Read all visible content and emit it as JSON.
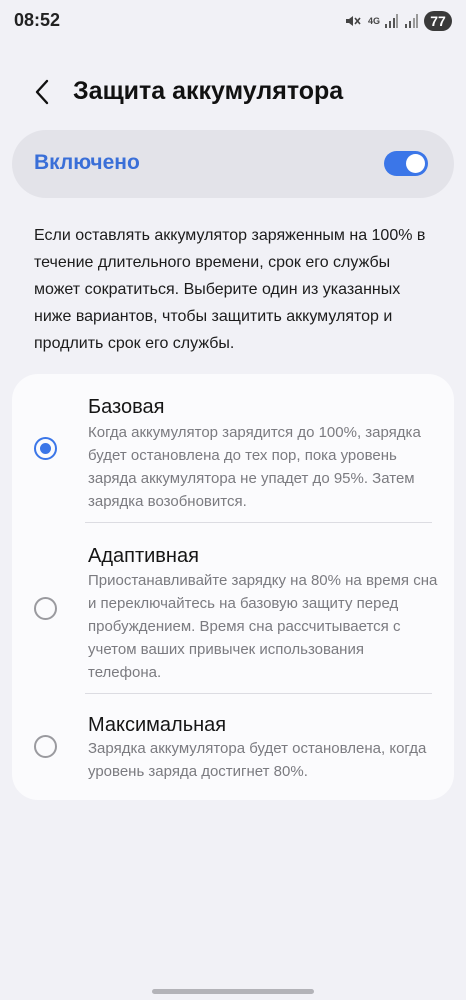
{
  "status_bar": {
    "time": "08:52",
    "network_label": "4G",
    "battery_level": "77",
    "icons": [
      "mute-icon",
      "signal-icon",
      "signal-icon"
    ]
  },
  "header": {
    "back_icon": "chevron-left-icon",
    "title": "Защита аккумулятора"
  },
  "master_switch": {
    "label": "Включено",
    "checked": true,
    "accent_color": "#3b76e8",
    "label_color": "#3a6fd8"
  },
  "description": "Если оставлять аккумулятор заряженным на 100% в течение длительного времени, срок его службы может сократиться. Выберите один из указанных ниже вариантов, чтобы защитить аккумулятор и продлить срок его службы.",
  "options": [
    {
      "title": "Базовая",
      "description": "Когда аккумулятор зарядится до 100%, зарядка будет остановлена до тех пор, пока уровень заряда аккумулятора не упадет до 95%. Затем зарядка возобновится.",
      "selected": true
    },
    {
      "title": "Адаптивная",
      "description": "Приостанавливайте зарядку на 80% на время сна и переключайтесь на базовую защиту перед пробуждением. Время сна рассчитывается с учетом ваших привычек использования телефона.",
      "selected": false
    },
    {
      "title": "Максимальная",
      "description": "Зарядка аккумулятора будет остановлена, когда уровень заряда достигнет 80%.",
      "selected": false
    }
  ]
}
